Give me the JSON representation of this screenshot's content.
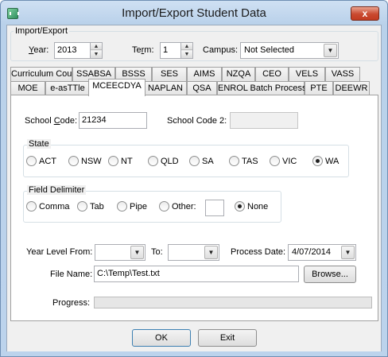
{
  "window": {
    "title": "Import/Export Student Data",
    "close_glyph": "x"
  },
  "import_export": {
    "group_title": "Import/Export",
    "year_label": "Year:",
    "year_value": "2013",
    "term_label": "Term:",
    "term_value": "1",
    "campus_label": "Campus:",
    "campus_value": "Not Selected"
  },
  "tabs_row1": [
    "Curriculum Council",
    "SSABSA",
    "BSSS",
    "SES",
    "AIMS",
    "NZQA",
    "CEO",
    "VELS",
    "VASS"
  ],
  "tabs_row2": [
    "MOE",
    "e-asTTle",
    "MCEECDYA",
    "NAPLAN",
    "QSA",
    "ENROL Batch Process",
    "PTE",
    "DEEWR"
  ],
  "active_tab": "MCEECDYA",
  "panel": {
    "school_code_label": "School Code:",
    "school_code_value": "21234",
    "school_code2_label": "School Code 2:",
    "school_code2_value": "",
    "state_group": "State",
    "states": [
      "ACT",
      "NSW",
      "NT",
      "QLD",
      "SA",
      "TAS",
      "VIC",
      "WA"
    ],
    "selected_state": "WA",
    "delimiter_group": "Field Delimiter",
    "delimiters": [
      "Comma",
      "Tab",
      "Pipe",
      "Other:"
    ],
    "delimiter_none": "None",
    "selected_delimiter": "None",
    "other_value": "",
    "year_from_label": "Year Level From:",
    "year_from_value": "",
    "to_label": "To:",
    "to_value": "",
    "process_date_label": "Process Date:",
    "process_date_value": "4/07/2014",
    "file_name_label": "File Name:",
    "file_name_value": "C:\\Temp\\Test.txt",
    "browse_label": "Browse...",
    "progress_label": "Progress:",
    "progress_value": 0
  },
  "footer": {
    "ok_label": "OK",
    "exit_label": "Exit"
  },
  "colors": {
    "accent": "#3c9f3c",
    "close": "#c94a30"
  }
}
